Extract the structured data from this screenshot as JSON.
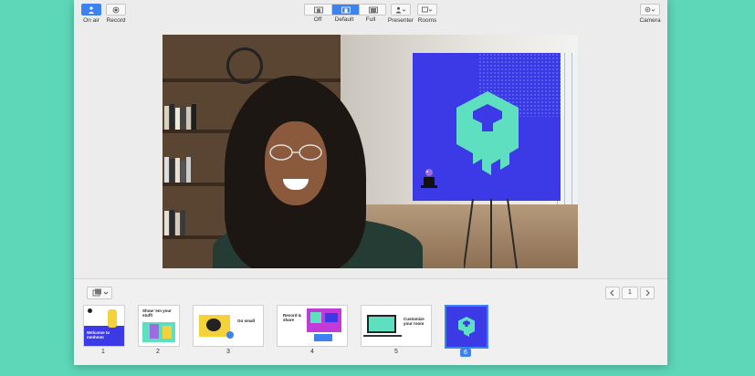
{
  "toolbar": {
    "on_air_label": "On air",
    "record_label": "Record",
    "layout_options": [
      "Off",
      "Default",
      "Full"
    ],
    "layout_selected": "Default",
    "presenter_label": "Presenter",
    "rooms_label": "Rooms",
    "camera_label": "Camera"
  },
  "pager": {
    "page": "1"
  },
  "slides": [
    {
      "number": "1",
      "text": "Welcome to mmhmm"
    },
    {
      "number": "2",
      "text": "Show 'em your stuff!"
    },
    {
      "number": "3",
      "text": "Go small"
    },
    {
      "number": "4",
      "text": "Record & share"
    },
    {
      "number": "5",
      "text": "Customize your room"
    },
    {
      "number": "6",
      "text": ""
    }
  ],
  "selected_slide": "6",
  "colors": {
    "accent": "#3c82f0",
    "poster": "#3b3ae6",
    "logo": "#5ee0c0",
    "background": "#5ed6b8"
  }
}
